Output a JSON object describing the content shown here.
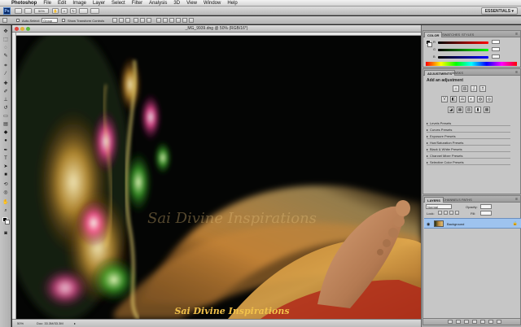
{
  "menubar": {
    "apple": "",
    "items": [
      "Photoshop",
      "File",
      "Edit",
      "Image",
      "Layer",
      "Select",
      "Filter",
      "Analysis",
      "3D",
      "View",
      "Window",
      "Help"
    ]
  },
  "appbar": {
    "logo": "Ps",
    "zoom": "50%",
    "workspace": "ESSENTIALS ▾"
  },
  "options": {
    "auto_select": "Auto-Select:",
    "auto_select_value": "Group",
    "transform": "Show Transform Controls"
  },
  "document": {
    "title": "_MG_9939.dng @ 50% (RGB/16*)",
    "status_zoom": "50%",
    "status_doc": "Doc: 33.3M/33.3M",
    "watermark": "Sai Divine Inspirations"
  },
  "color_panel": {
    "tabs": [
      "COLOR",
      "SWATCHES",
      "STYLES"
    ],
    "sliders": [
      "R",
      "G",
      "B"
    ]
  },
  "adjustments_panel": {
    "tabs": [
      "ADJUSTMENTS",
      "MASKS"
    ],
    "title": "Add an adjustment",
    "presets": [
      "Levels Presets",
      "Curves Presets",
      "Exposure Presets",
      "Hue/Saturation Presets",
      "Black & White Presets",
      "Channel Mixer Presets",
      "Selective Color Presets"
    ]
  },
  "layers_panel": {
    "tabs": [
      "LAYERS",
      "CHANNELS",
      "PATHS"
    ],
    "blend": "Normal",
    "opacity_label": "Opacity:",
    "fill_label": "Fill:",
    "lock_label": "Lock:",
    "layer_name": "Background"
  }
}
